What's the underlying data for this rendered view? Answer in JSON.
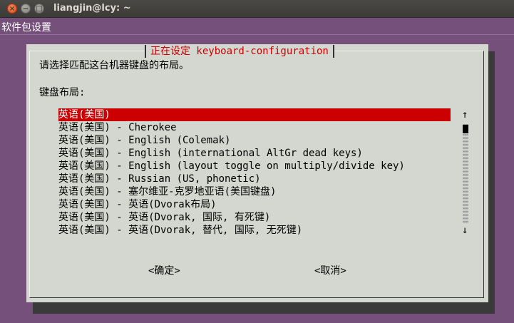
{
  "window": {
    "title": "liangjin@lcy: ~",
    "controls": [
      "close-icon",
      "minimize-icon",
      "maximize-icon"
    ],
    "close_glyph": "×",
    "min_glyph": "−",
    "max_glyph": "□"
  },
  "backtitle": "软件包设置",
  "dialog": {
    "title": "正在设定 keyboard-configuration",
    "prompt": "请选择匹配这台机器键盘的布局。",
    "list_label": "键盘布局:",
    "items": [
      "英语(美国)",
      "英语(美国) - Cherokee",
      "英语(美国) - English (Colemak)",
      "英语(美国) - English (international AltGr dead keys)",
      "英语(美国) - English (layout toggle on multiply/divide key)",
      "英语(美国) - Russian (US, phonetic)",
      "英语(美国) - 塞尔维亚-克罗地亚语(美国键盘)",
      "英语(美国) - 英语(Dvorak布局)",
      "英语(美国) - 英语(Dvorak, 国际, 有死键)",
      "英语(美国) - 英语(Dvorak, 替代, 国际, 无死键)"
    ],
    "selected_index": 0,
    "scroll_up": "↑",
    "scroll_down": "↓",
    "ok_label": "<确定>",
    "cancel_label": "<取消>"
  },
  "colors": {
    "desktop": "#75507b",
    "dialog_bg": "#d3d7cf",
    "highlight": "#cc0000",
    "shadow": "#3a3a3a"
  }
}
